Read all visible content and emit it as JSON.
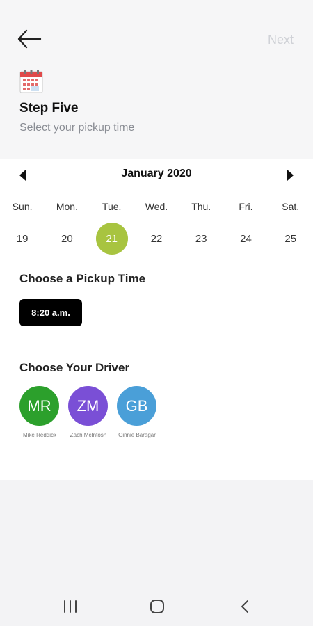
{
  "header": {
    "next_label": "Next",
    "step_title": "Step Five",
    "step_subtitle": "Select your pickup time"
  },
  "calendar": {
    "month": "January 2020",
    "weekdays": [
      "Sun.",
      "Mon.",
      "Tue.",
      "Wed.",
      "Thu.",
      "Fri.",
      "Sat."
    ],
    "days": [
      "19",
      "20",
      "21",
      "22",
      "23",
      "24",
      "25"
    ],
    "selected_day": "21",
    "selected_color": "#a8c440"
  },
  "pickup": {
    "section_title": "Choose a Pickup Time",
    "time": "8:20 a.m."
  },
  "drivers": {
    "section_title": "Choose Your Driver",
    "list": [
      {
        "initials": "MR",
        "name": "Mike Reddick",
        "color": "#2ca02c"
      },
      {
        "initials": "ZM",
        "name": "Zach McIntosh",
        "color": "#7a4fd6"
      },
      {
        "initials": "GB",
        "name": "Ginnie Baragar",
        "color": "#4a9fd8"
      }
    ]
  },
  "icons": {
    "back": "arrow-left-icon",
    "calendar": "calendar-icon",
    "prev_month": "triangle-left-icon",
    "next_month": "triangle-right-icon",
    "nav_recent": "recent-apps-icon",
    "nav_home": "home-icon",
    "nav_back": "chevron-left-icon"
  }
}
